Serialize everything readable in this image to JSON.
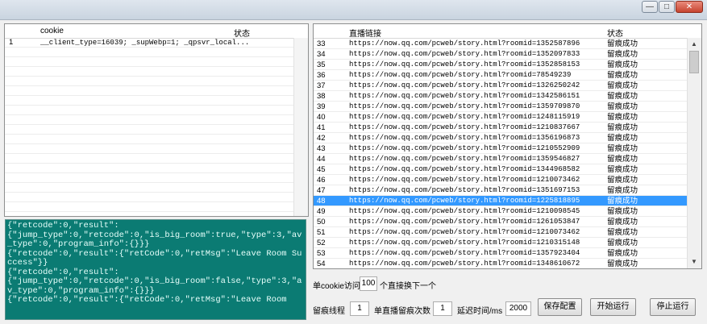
{
  "window": {
    "title": "",
    "min_label": "—",
    "max_label": "□",
    "close_label": "✕"
  },
  "cookie_table": {
    "columns": [
      "cookie",
      "状态"
    ],
    "rows": [
      {
        "no": "1",
        "cookie": "__client_type=16039; _supWebp=1; _qpsvr_local...",
        "status": ""
      }
    ]
  },
  "room_table": {
    "columns": [
      "直播链接",
      "状态"
    ],
    "selected_no": "48",
    "rows": [
      {
        "no": "33",
        "url": "https://now.qq.com/pcweb/story.html?roomid=1352587896",
        "status": "留痕成功"
      },
      {
        "no": "34",
        "url": "https://now.qq.com/pcweb/story.html?roomid=1352097833",
        "status": "留痕成功"
      },
      {
        "no": "35",
        "url": "https://now.qq.com/pcweb/story.html?roomid=1352858153",
        "status": "留痕成功"
      },
      {
        "no": "36",
        "url": "https://now.qq.com/pcweb/story.html?roomid=78549239",
        "status": "留痕成功"
      },
      {
        "no": "37",
        "url": "https://now.qq.com/pcweb/story.html?roomid=1326250242",
        "status": "留痕成功"
      },
      {
        "no": "38",
        "url": "https://now.qq.com/pcweb/story.html?roomid=1342586151",
        "status": "留痕成功"
      },
      {
        "no": "39",
        "url": "https://now.qq.com/pcweb/story.html?roomid=1359709870",
        "status": "留痕成功"
      },
      {
        "no": "40",
        "url": "https://now.qq.com/pcweb/story.html?roomid=1248115919",
        "status": "留痕成功"
      },
      {
        "no": "41",
        "url": "https://now.qq.com/pcweb/story.html?roomid=1210837667",
        "status": "留痕成功"
      },
      {
        "no": "42",
        "url": "https://now.qq.com/pcweb/story.html?roomid=1356196873",
        "status": "留痕成功"
      },
      {
        "no": "43",
        "url": "https://now.qq.com/pcweb/story.html?roomid=1210552909",
        "status": "留痕成功"
      },
      {
        "no": "44",
        "url": "https://now.qq.com/pcweb/story.html?roomid=1359546827",
        "status": "留痕成功"
      },
      {
        "no": "45",
        "url": "https://now.qq.com/pcweb/story.html?roomid=1344968582",
        "status": "留痕成功"
      },
      {
        "no": "46",
        "url": "https://now.qq.com/pcweb/story.html?roomid=1210073462",
        "status": "留痕成功"
      },
      {
        "no": "47",
        "url": "https://now.qq.com/pcweb/story.html?roomid=1351697153",
        "status": "留痕成功"
      },
      {
        "no": "48",
        "url": "https://now.qq.com/pcweb/story.html?roomid=1225818895",
        "status": "留痕成功"
      },
      {
        "no": "49",
        "url": "https://now.qq.com/pcweb/story.html?roomid=1210098545",
        "status": "留痕成功"
      },
      {
        "no": "50",
        "url": "https://now.qq.com/pcweb/story.html?roomid=1261053847",
        "status": "留痕成功"
      },
      {
        "no": "51",
        "url": "https://now.qq.com/pcweb/story.html?roomid=1210073462",
        "status": "留痕成功"
      },
      {
        "no": "52",
        "url": "https://now.qq.com/pcweb/story.html?roomid=1210315148",
        "status": "留痕成功"
      },
      {
        "no": "53",
        "url": "https://now.qq.com/pcweb/story.html?roomid=1357923404",
        "status": "留痕成功"
      },
      {
        "no": "54",
        "url": "https://now.qq.com/pcweb/story.html?roomid=1348610672",
        "status": "留痕成功"
      }
    ]
  },
  "log_lines": [
    "{\"retcode\":0,\"result\":",
    "{\"jump_type\":0,\"retcode\":0,\"is_big_room\":true,\"type\":3,\"av_type\":0,\"program_info\":{}}}",
    "{\"retcode\":0,\"result\":{\"retCode\":0,\"retMsg\":\"Leave Room Success\"}}",
    "{\"retcode\":0,\"result\":",
    "{\"jump_type\":0,\"retcode\":0,\"is_big_room\":false,\"type\":3,\"av_type\":0,\"program_info\":{}}}",
    "{\"retcode\":0,\"result\":{\"retCode\":0,\"retMsg\":\"Leave Room"
  ],
  "controls": {
    "per_cookie_prefix": "单cookie访问",
    "per_cookie_value": "100",
    "per_cookie_suffix": "个直接换下一个",
    "threads_label": "留痕线程",
    "threads_value": "1",
    "per_room_label": "单直播留痕次数",
    "per_room_value": "1",
    "delay_label": "延迟时间/ms",
    "delay_value": "2000",
    "save_button": "保存配置",
    "start_button": "开始运行",
    "stop_button": "停止运行"
  },
  "colors": {
    "selection": "#3399ff",
    "log_bg": "#0b7b73"
  }
}
